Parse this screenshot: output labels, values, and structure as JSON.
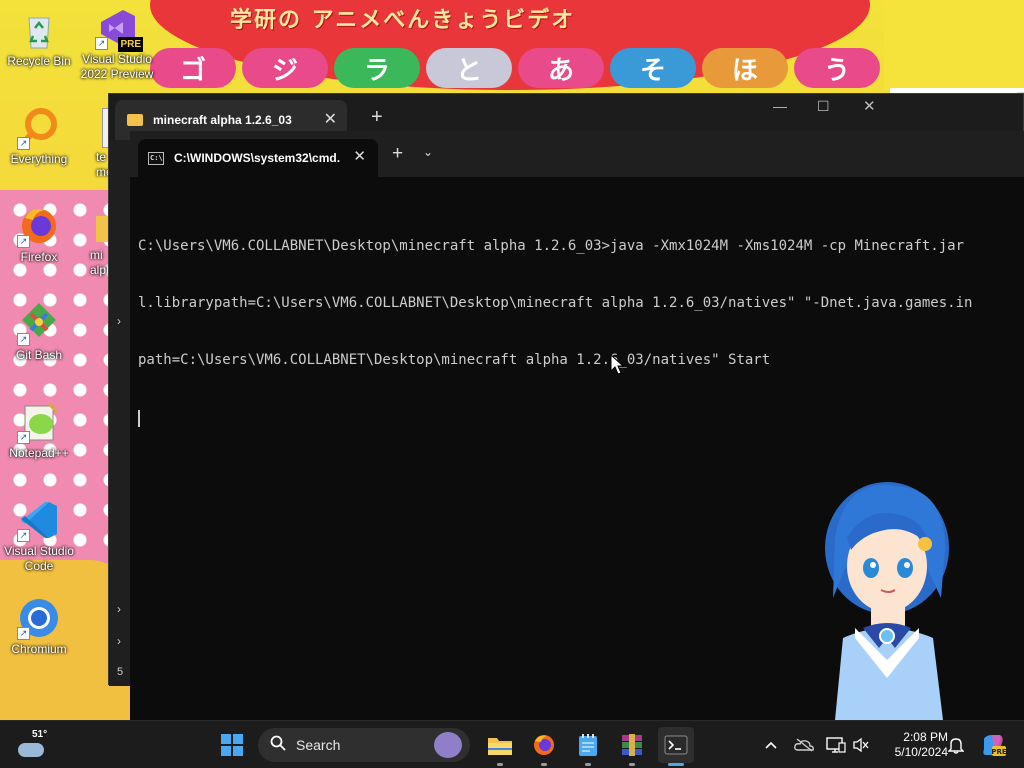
{
  "wallpaper": {
    "banner": "学研の アニメべんきょうビデオ",
    "bubble_text": [
      "ゴ",
      "ジ",
      "ラ",
      "と",
      "あ",
      "そ",
      "ほ",
      "う"
    ],
    "bubble_colors": [
      "#e84a8a",
      "#e84a8a",
      "#3ab85a",
      "#c8c8d8",
      "#e84a8a",
      "#3a9ad8",
      "#e89a3a",
      "#e84a8a"
    ]
  },
  "desktop_icons": [
    {
      "name": "recycle-bin",
      "label": "Recycle Bin",
      "icon": "recycle-bin-icon"
    },
    {
      "name": "visual-studio-2022-preview",
      "label": "Visual Studio 2022 Preview",
      "icon": "visual-studio-icon",
      "badge": "PRE"
    },
    {
      "name": "everything",
      "label": "Everything",
      "icon": "everything-icon"
    },
    {
      "name": "te-mess-partial",
      "label": "te mess",
      "icon": "text-file-icon"
    },
    {
      "name": "firefox",
      "label": "Firefox",
      "icon": "firefox-icon"
    },
    {
      "name": "minecraft-alpha-partial",
      "label": "mi alpha",
      "icon": "folder-icon"
    },
    {
      "name": "git-bash",
      "label": "Git Bash",
      "icon": "git-bash-icon"
    },
    {
      "name": "notepad-plus-plus",
      "label": "Notepad++",
      "icon": "notepad-plus-plus-icon"
    },
    {
      "name": "visual-studio-code",
      "label": "Visual Studio Code",
      "icon": "vscode-icon"
    },
    {
      "name": "chromium",
      "label": "Chromium",
      "icon": "chromium-icon"
    }
  ],
  "explorer": {
    "tab_title": "minecraft alpha 1.2.6_03",
    "new_tab": "+",
    "close": "✕",
    "minimize": "—",
    "maximize": "☐",
    "left_number": "5"
  },
  "terminal": {
    "tab_title": "C:\\WINDOWS\\system32\\cmd.",
    "new_tab": "+",
    "dropdown": "⌄",
    "close": "✕",
    "lines": [
      "C:\\Users\\VM6.COLLABNET\\Desktop\\minecraft alpha 1.2.6_03>java -Xmx1024M -Xms1024M -cp Minecraft.jar",
      "l.librarypath=C:\\Users\\VM6.COLLABNET\\Desktop\\minecraft alpha 1.2.6_03/natives\" \"-Dnet.java.games.in",
      "path=C:\\Users\\VM6.COLLABNET\\Desktop\\minecraft alpha 1.2.6_03/natives\" Start"
    ]
  },
  "taskbar": {
    "weather_temp": "51°",
    "search_placeholder": "Search",
    "clock_time": "2:08 PM",
    "clock_date": "5/10/2024",
    "pinned": [
      "file-explorer-icon",
      "firefox-icon",
      "notepad-icon",
      "winrar-icon",
      "terminal-icon"
    ]
  },
  "colors": {
    "terminal_bg": "#0c0c0c",
    "terminal_text": "#cccccc",
    "accent": "#4aa8f0"
  }
}
